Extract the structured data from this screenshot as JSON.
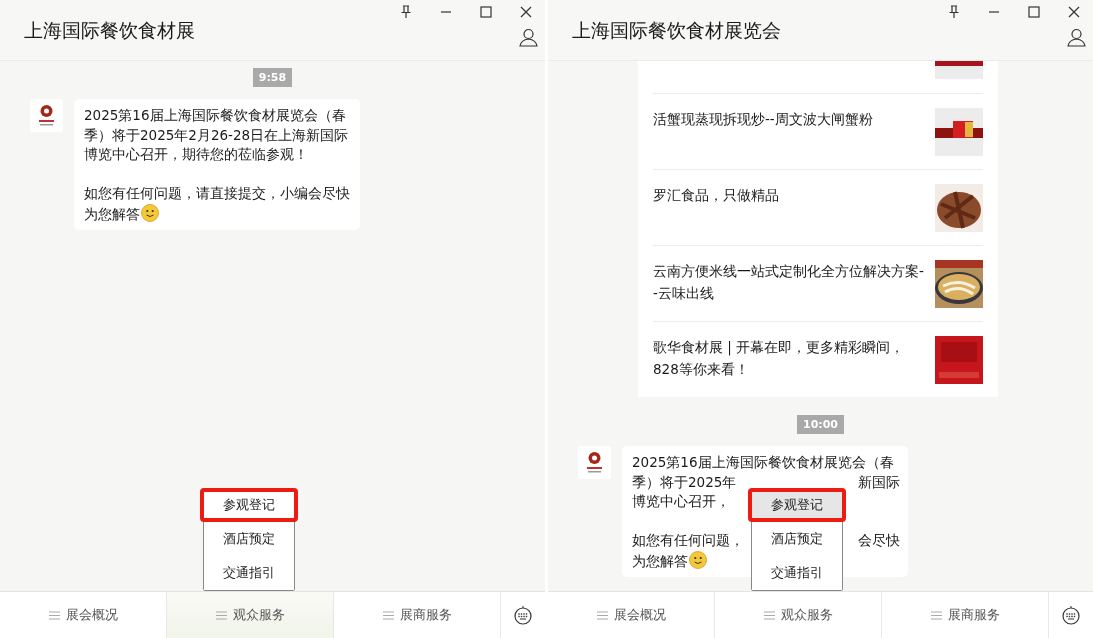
{
  "panes": [
    {
      "title": "上海国际餐饮食材展",
      "timestamp": "9:58",
      "message": {
        "paragraphs": [
          [
            {
              "left": "2025第16届上海国际餐饮食材展览会（春"
            },
            {
              "left": "季）将于2025年2月26-28日在上海新国际"
            },
            {
              "left": "博览中心召开，期待您的莅临参观！"
            }
          ],
          [
            {
              "left": "如您有任何问题，请直接提交，小编会尽快"
            },
            {
              "left": "为您解答"
            }
          ]
        ]
      },
      "popup_menu": [
        {
          "label": "参观登记",
          "selected": false,
          "highlighted": true
        },
        {
          "label": "酒店预定",
          "selected": false,
          "highlighted": false
        },
        {
          "label": "交通指引",
          "selected": false,
          "highlighted": false
        }
      ],
      "bottom_menu": [
        {
          "label": "展会概况",
          "selected": false
        },
        {
          "label": "观众服务",
          "selected": true
        },
        {
          "label": "展商服务",
          "selected": false
        }
      ]
    },
    {
      "title": "上海国际餐饮食材展览会",
      "articles": [
        {
          "title": "活蟹现蒸现拆现炒--周文波大闸蟹粉",
          "kind": "picture"
        },
        {
          "title": "罗汇食品，只做精品",
          "kind": "picture"
        },
        {
          "title": "云南方便米线一站式定制化全方位解决方案--云味出线",
          "kind": "picture"
        },
        {
          "title": "歌华食材展 | 开幕在即，更多精彩瞬间，828等你来看！",
          "kind": "picture"
        }
      ],
      "timestamp": "10:00",
      "message": {
        "paragraphs": [
          [
            {
              "left": "2025第16届上海国际餐饮食材展览会（春"
            },
            {
              "left": "季）将于2025年",
              "right": "新国际"
            },
            {
              "left": "博览中心召开，"
            }
          ],
          [
            {
              "left": "如您有任何问题，",
              "right": "会尽快"
            },
            {
              "left": "为您解答"
            }
          ]
        ]
      },
      "popup_menu": [
        {
          "label": "参观登记",
          "selected": true,
          "highlighted": true
        },
        {
          "label": "酒店预定",
          "selected": false,
          "highlighted": false
        },
        {
          "label": "交通指引",
          "selected": false,
          "highlighted": false
        }
      ],
      "bottom_menu": [
        {
          "label": "展会概况",
          "selected": false
        },
        {
          "label": "观众服务",
          "selected": false
        },
        {
          "label": "展商服务",
          "selected": false
        }
      ]
    }
  ]
}
